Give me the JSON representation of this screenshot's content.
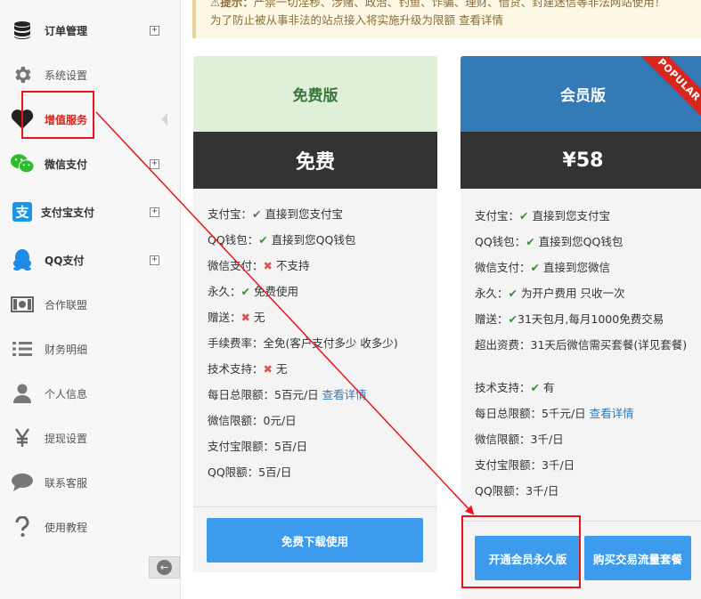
{
  "sidebar": {
    "items": [
      {
        "label": "订单管理",
        "icon": "database-icon",
        "expandable": true
      },
      {
        "label": "系统设置",
        "icon": "gear-icon",
        "expandable": false
      },
      {
        "label": "增值服务",
        "icon": "heart-icon",
        "expandable": false
      },
      {
        "label": "微信支付",
        "icon": "wechat-icon",
        "expandable": true
      },
      {
        "label": "支付宝支付",
        "icon": "alipay-icon",
        "expandable": true
      },
      {
        "label": "QQ支付",
        "icon": "qq-icon",
        "expandable": true
      },
      {
        "label": "合作联盟",
        "icon": "money-icon",
        "expandable": false
      },
      {
        "label": "财务明细",
        "icon": "list-icon",
        "expandable": false
      },
      {
        "label": "个人信息",
        "icon": "user-icon",
        "expandable": false
      },
      {
        "label": "提现设置",
        "icon": "yen-icon",
        "expandable": false
      },
      {
        "label": "联系客服",
        "icon": "chat-icon",
        "expandable": false
      },
      {
        "label": "使用教程",
        "icon": "question-icon",
        "expandable": false
      }
    ],
    "expand_glyph": "+",
    "collapse_glyph": "←"
  },
  "alert": {
    "prefix": "提示：",
    "line1": "严禁一切淫秽、涉赌、政治、钓鱼、诈骗、理财、借贷、封建迷信等非法网站使用！",
    "line2": "为了防止被从事非法的站点接入将实施升级为限额",
    "link": "查看详情"
  },
  "plans": {
    "free": {
      "title": "免费版",
      "price": "免费",
      "features": {
        "alipay_key": "支付宝：",
        "alipay_val": "直接到您支付宝",
        "qq_key": "QQ钱包：",
        "qq_val": "直接到您QQ钱包",
        "wechat_key": "微信支付：",
        "wechat_val": "不支持",
        "forever_key": "永久：",
        "forever_val": "免费使用",
        "gift_key": "赠送：",
        "gift_val": "无",
        "fee": "手续费率：全免(客户支付多少 收多少)",
        "support_key": "技术支持：",
        "support_val": "无",
        "daily_total": "每日总限额：5百元/日",
        "daily_link": "查看详情",
        "wechat_limit": "微信限额：0元/日",
        "alipay_limit": "支付宝限额：5百/日",
        "qq_limit": "QQ限额：5百/日"
      },
      "button": "免费下载使用"
    },
    "vip": {
      "title": "会员版",
      "price": "¥58",
      "ribbon": "POPULAR",
      "features": {
        "alipay_key": "支付宝：",
        "alipay_val": "直接到您支付宝",
        "qq_key": "QQ钱包：",
        "qq_val": "直接到您QQ钱包",
        "wechat_key": "微信支付：",
        "wechat_val": "直接到您微信",
        "forever_key": "永久：",
        "forever_val": "为开户费用 只收一次",
        "gift_key": "赠送：",
        "gift_val": "31天包月,每月1000免费交易",
        "overflow": "超出资费：31天后微信需买套餐(详见套餐)",
        "support_key": "技术支持：",
        "support_val": "有",
        "daily_total": "每日总限额：5千元/日",
        "daily_link": "查看详情",
        "wechat_limit": "微信限额：3千/日",
        "alipay_limit": "支付宝限额：3千/日",
        "qq_limit": "QQ限额：3千/日"
      },
      "button_open": "开通会员永久版",
      "button_buy": "购买交易流量套餐"
    }
  },
  "colors": {
    "annotation_red": "#e8141b",
    "primary_blue": "#337ab7",
    "button_blue": "#3c9bec",
    "free_header_bg": "#dff0d8",
    "dark_price_bg": "#333333"
  }
}
